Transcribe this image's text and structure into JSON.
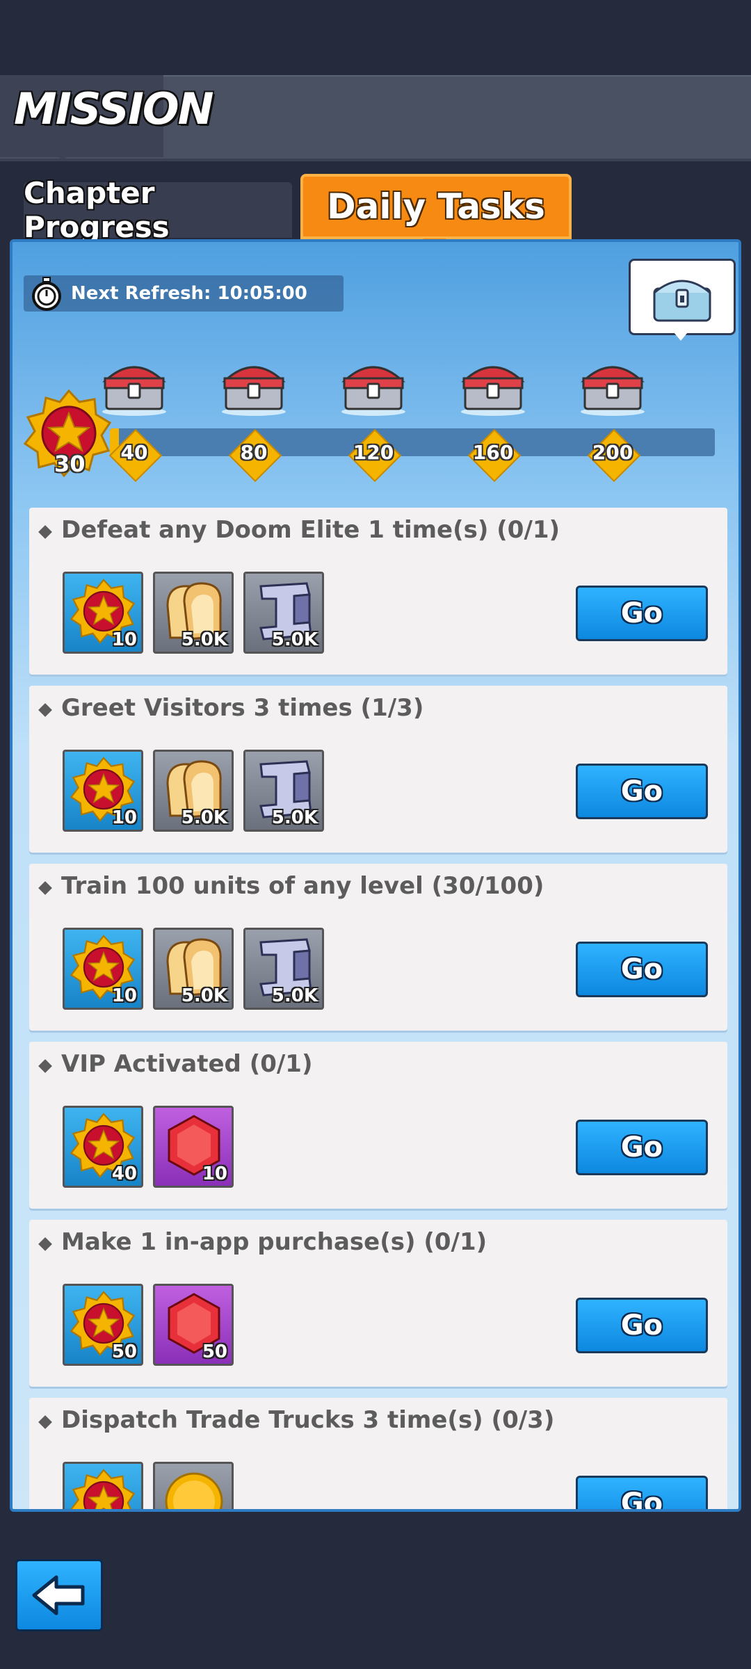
{
  "header": {
    "title": "MISSION"
  },
  "tabs": {
    "chapter": "Chapter Progress",
    "daily": "Daily Tasks"
  },
  "refresh": {
    "label": "Next Refresh: 10:05:00"
  },
  "points": {
    "current": "30",
    "max": 200
  },
  "milestones": [
    {
      "value": "40",
      "icon": "chest-icon"
    },
    {
      "value": "80",
      "icon": "chest-icon"
    },
    {
      "value": "120",
      "icon": "chest-icon"
    },
    {
      "value": "160",
      "icon": "chest-icon"
    },
    {
      "value": "200",
      "icon": "chest-icon"
    }
  ],
  "tasks": [
    {
      "title": "Defeat any Doom Elite 1 time(s) (0/1)",
      "rewards": [
        {
          "icon": "medal-icon",
          "qty": "10"
        },
        {
          "icon": "bread-icon",
          "qty": "5.0K"
        },
        {
          "icon": "iron-icon",
          "qty": "5.0K"
        }
      ],
      "button": "Go"
    },
    {
      "title": "Greet Visitors 3 times (1/3)",
      "rewards": [
        {
          "icon": "medal-icon",
          "qty": "10"
        },
        {
          "icon": "bread-icon",
          "qty": "5.0K"
        },
        {
          "icon": "iron-icon",
          "qty": "5.0K"
        }
      ],
      "button": "Go"
    },
    {
      "title": "Train 100 units of any level (30/100)",
      "rewards": [
        {
          "icon": "medal-icon",
          "qty": "10"
        },
        {
          "icon": "bread-icon",
          "qty": "5.0K"
        },
        {
          "icon": "iron-icon",
          "qty": "5.0K"
        }
      ],
      "button": "Go"
    },
    {
      "title": "VIP Activated (0/1)",
      "rewards": [
        {
          "icon": "medal-icon",
          "qty": "40"
        },
        {
          "icon": "gem-icon",
          "qty": "10"
        }
      ],
      "button": "Go"
    },
    {
      "title": "Make 1 in-app purchase(s) (0/1)",
      "rewards": [
        {
          "icon": "medal-icon",
          "qty": "50"
        },
        {
          "icon": "gem-icon",
          "qty": "50"
        }
      ],
      "button": "Go"
    },
    {
      "title": "Dispatch Trade Trucks 3 time(s) (0/3)",
      "rewards": [
        {
          "icon": "medal-icon",
          "qty": ""
        },
        {
          "icon": "coin-icon",
          "qty": ""
        }
      ],
      "button": "Go"
    }
  ],
  "colors": {
    "accent": "#f78a12",
    "button": "#1a9ef0",
    "panel": "#8cc6f2"
  }
}
